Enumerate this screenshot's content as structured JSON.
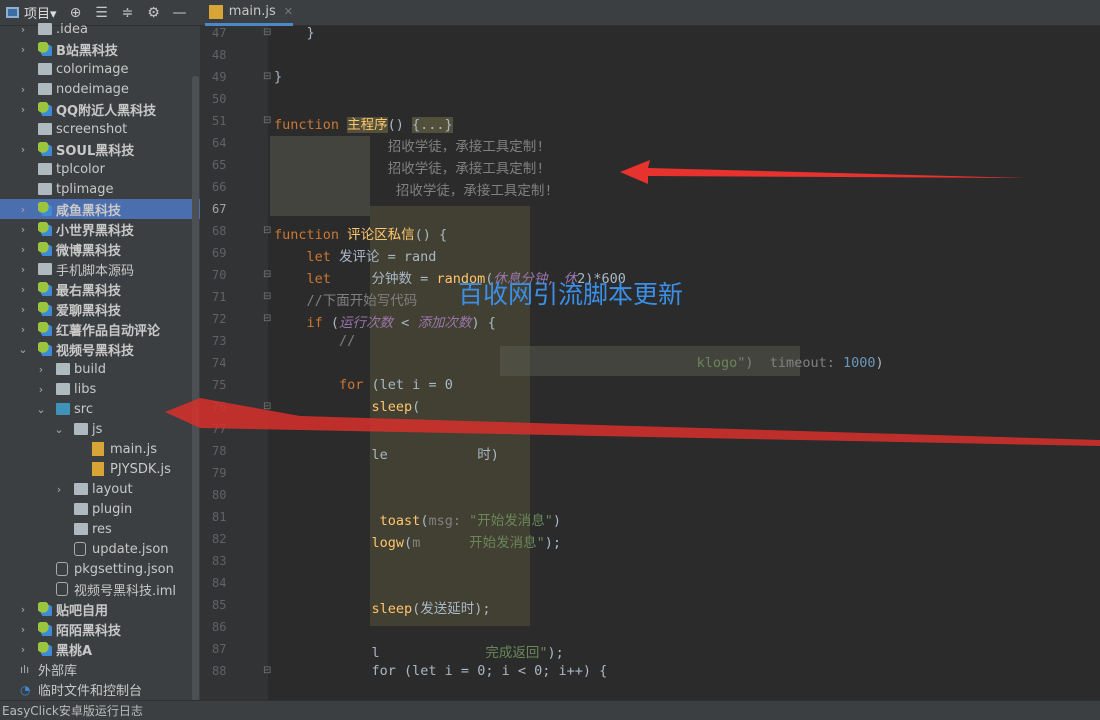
{
  "toolbar": {
    "project_label": "项目▾",
    "icons": [
      "locate-icon",
      "expand-all-icon",
      "collapse-all-icon",
      "gear-icon",
      "minimize-icon"
    ]
  },
  "tabs": [
    {
      "label": "main.js",
      "icon": "js-file-icon",
      "active": true
    }
  ],
  "sidebar": {
    "items": [
      {
        "label": ".idea",
        "type": "folder",
        "level": 0,
        "chevron": "right"
      },
      {
        "label": "B站黑科技",
        "type": "module",
        "level": 0,
        "chevron": "right"
      },
      {
        "label": "colorimage",
        "type": "folder",
        "level": 0
      },
      {
        "label": "nodeimage",
        "type": "folder",
        "level": 0,
        "chevron": "right"
      },
      {
        "label": "QQ附近人黑科技",
        "type": "module",
        "level": 0,
        "chevron": "right"
      },
      {
        "label": "screenshot",
        "type": "folder",
        "level": 0
      },
      {
        "label": "SOUL黑科技",
        "type": "module",
        "level": 0,
        "chevron": "right"
      },
      {
        "label": "tplcolor",
        "type": "folder",
        "level": 0
      },
      {
        "label": "tplimage",
        "type": "folder",
        "level": 0
      },
      {
        "label": "咸鱼黑科技",
        "type": "module",
        "level": 0,
        "chevron": "right",
        "selected": true
      },
      {
        "label": "小世界黑科技",
        "type": "module",
        "level": 0,
        "chevron": "right"
      },
      {
        "label": "微博黑科技",
        "type": "module",
        "level": 0,
        "chevron": "right"
      },
      {
        "label": "手机脚本源码",
        "type": "folder",
        "level": 0,
        "chevron": "right"
      },
      {
        "label": "最右黑科技",
        "type": "module",
        "level": 0,
        "chevron": "right"
      },
      {
        "label": "爱聊黑科技",
        "type": "module",
        "level": 0,
        "chevron": "right"
      },
      {
        "label": "红薯作品自动评论",
        "type": "module",
        "level": 0,
        "chevron": "right"
      },
      {
        "label": "视频号黑科技",
        "type": "module",
        "level": 0,
        "chevron": "down"
      },
      {
        "label": "build",
        "type": "folder",
        "level": 1,
        "chevron": "right"
      },
      {
        "label": "libs",
        "type": "folder",
        "level": 1,
        "chevron": "right"
      },
      {
        "label": "src",
        "type": "folder-blue",
        "level": 1,
        "chevron": "down"
      },
      {
        "label": "js",
        "type": "folder",
        "level": 2,
        "chevron": "down"
      },
      {
        "label": "main.js",
        "type": "js",
        "level": 3
      },
      {
        "label": "PJYSDK.js",
        "type": "js",
        "level": 3
      },
      {
        "label": "layout",
        "type": "folder",
        "level": 2,
        "chevron": "right"
      },
      {
        "label": "plugin",
        "type": "folder",
        "level": 2
      },
      {
        "label": "res",
        "type": "folder",
        "level": 2
      },
      {
        "label": "update.json",
        "type": "json",
        "level": 2
      },
      {
        "label": "pkgsetting.json",
        "type": "json",
        "level": 1
      },
      {
        "label": "视频号黑科技.iml",
        "type": "json",
        "level": 1
      },
      {
        "label": "贴吧自用",
        "type": "module",
        "level": 0,
        "chevron": "right"
      },
      {
        "label": "陌陌黑科技",
        "type": "module",
        "level": 0,
        "chevron": "right"
      },
      {
        "label": "黑桃A",
        "type": "module",
        "level": 0,
        "chevron": "right"
      },
      {
        "label": "外部库",
        "type": "lib",
        "level": -1
      },
      {
        "label": "临时文件和控制台",
        "type": "scratch",
        "level": -1
      }
    ]
  },
  "editor": {
    "line_numbers": [
      "47",
      "48",
      "49",
      "50",
      "51",
      "64",
      "65",
      "66",
      "67",
      "68",
      "69",
      "70",
      "71",
      "72",
      "73",
      "74",
      "75",
      "76",
      "77",
      "78",
      "79",
      "80",
      "81",
      "82",
      "83",
      "84",
      "85",
      "86",
      "87",
      "88"
    ],
    "current_line": "67",
    "lines": [
      [
        [
          "",
          "    }"
        ]
      ],
      [],
      [
        [
          "",
          "}"
        ]
      ],
      [],
      [
        [
          "kw",
          "function "
        ],
        [
          "fn hl",
          "主程序"
        ],
        [
          "",
          "() "
        ],
        [
          "hl",
          "{...}"
        ]
      ],
      [
        [
          "cm",
          "              招收学徒，承接工具定制!"
        ]
      ],
      [
        [
          "cm",
          "              招收学徒，承接工具定制!"
        ]
      ],
      [
        [
          "cm",
          "               招收学徒，承接工具定制!"
        ]
      ],
      [],
      [
        [
          "kw",
          "function "
        ],
        [
          "fn",
          "评论区私信"
        ],
        [
          "",
          "() {"
        ]
      ],
      [
        [
          "kw",
          "    let "
        ],
        [
          "",
          "发评论 = rand"
        ]
      ],
      [
        [
          "kw",
          "    let "
        ],
        [
          "",
          "    分钟数 = "
        ],
        [
          "fn",
          "random"
        ],
        [
          "",
          "("
        ],
        [
          "pu",
          "休息分钟, 休"
        ],
        [
          "",
          "2)*600"
        ]
      ],
      [
        [
          "cm",
          "    //下面开始写代码"
        ]
      ],
      [
        [
          "kw",
          "    if "
        ],
        [
          "",
          "("
        ],
        [
          "pu",
          "运行次数"
        ],
        [
          "",
          " < "
        ],
        [
          "pu",
          "添加次数"
        ],
        [
          "",
          ") {"
        ]
      ],
      [
        [
          "cm",
          "        //"
        ]
      ],
      [
        [
          "",
          "        "
        ],
        [
          "str",
          "                                            klogo\""
        ],
        [
          "cm",
          ")  timeout: "
        ],
        [
          "num",
          "1000"
        ],
        [
          "",
          ")"
        ]
      ],
      [
        [
          "kw",
          "        for "
        ],
        [
          "",
          "(let i = 0"
        ]
      ],
      [
        [
          "fn",
          "            sleep"
        ],
        [
          "",
          "("
        ]
      ],
      [],
      [
        [
          "",
          "            le"
        ],
        [
          "",
          "           时)"
        ]
      ],
      [],
      [],
      [
        [
          "fn",
          "             toast"
        ],
        [
          "",
          "("
        ],
        [
          "cm",
          "msg: "
        ],
        [
          "str",
          "\"开始发消息\""
        ],
        [
          "",
          ")"
        ]
      ],
      [
        [
          "fn",
          "            logw"
        ],
        [
          "",
          "("
        ],
        [
          "cm",
          "m"
        ],
        [
          "str",
          "      开始发消息\""
        ],
        [
          "",
          ");"
        ]
      ],
      [],
      [],
      [
        [
          "fn",
          "            sleep"
        ],
        [
          "",
          "(发送延时);"
        ]
      ],
      [],
      [
        [
          "",
          "            l"
        ],
        [
          "str",
          "             完成返回\""
        ],
        [
          "",
          ");"
        ]
      ],
      [
        [
          "",
          "            for (let i = 0; i < 0; i++) {"
        ]
      ]
    ]
  },
  "overlay": {
    "watermark": "百收网引流脚本更新",
    "arrow_color": "#e8322e",
    "watermark_color": "#3b8fe8"
  },
  "status_bar": {
    "text": "EasyClick安卓版运行日志"
  },
  "colors": {
    "selection": "#4b6eaf",
    "keyword": "#cc7832",
    "function": "#ffc66d",
    "panel": "#3c3f41",
    "editor": "#2b2b2b"
  }
}
